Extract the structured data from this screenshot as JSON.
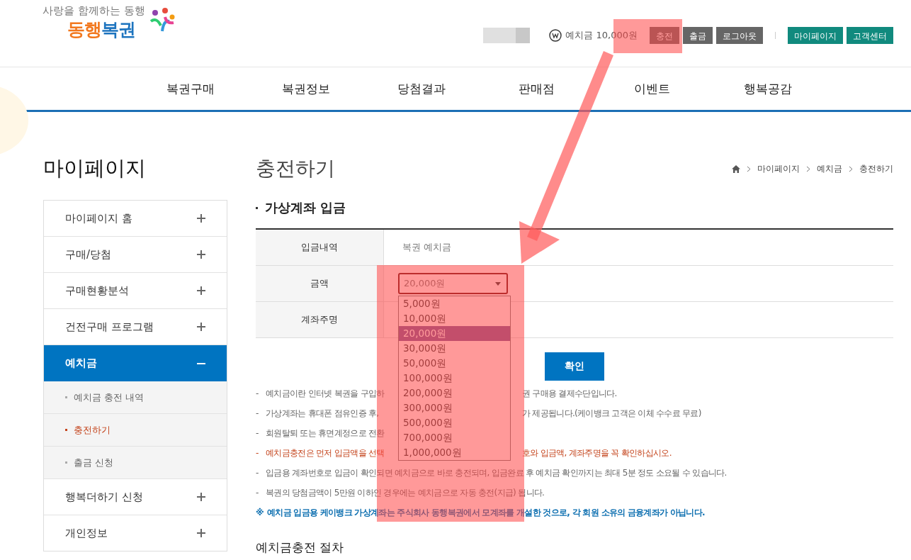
{
  "header": {
    "logo": {
      "tagline": "사랑을 함께하는 동행",
      "name_first": "동행",
      "name_second": "복권"
    },
    "balance_label": "예치금",
    "balance": "10,000원",
    "account_buttons": [
      {
        "label": "충전",
        "kind": "dark"
      },
      {
        "label": "출금",
        "kind": "dark"
      },
      {
        "label": "로그아웃",
        "kind": "dark"
      },
      {
        "label": "마이페이지",
        "kind": "accent"
      },
      {
        "label": "고객센터",
        "kind": "accent"
      }
    ]
  },
  "nav": [
    "복권구매",
    "복권정보",
    "당첨결과",
    "판매점",
    "이벤트",
    "행복공감"
  ],
  "sidebar": {
    "title": "마이페이지",
    "items": [
      {
        "label": "마이페이지 홈",
        "expanded": false,
        "selected": false
      },
      {
        "label": "구매/당첨",
        "expanded": false,
        "selected": false
      },
      {
        "label": "구매현황분석",
        "expanded": false,
        "selected": false
      },
      {
        "label": "건전구매 프로그램",
        "expanded": false,
        "selected": false
      },
      {
        "label": "예치금",
        "expanded": true,
        "selected": true,
        "children": [
          {
            "label": "예치금 충전 내역",
            "selected": false
          },
          {
            "label": "충전하기",
            "selected": true
          },
          {
            "label": "출금 신청",
            "selected": false
          }
        ]
      },
      {
        "label": "행복더하기 신청",
        "expanded": false,
        "selected": false
      },
      {
        "label": "개인정보",
        "expanded": false,
        "selected": false
      }
    ]
  },
  "page": {
    "title": "충전하기",
    "breadcrumb": [
      "마이페이지",
      "예치금",
      "충전하기"
    ]
  },
  "section_heading": "가상계좌 입금",
  "form": {
    "rows": [
      {
        "label": "입금내역",
        "kind": "text",
        "value": "복권 예치금"
      },
      {
        "label": "금액",
        "kind": "select",
        "value": "20,000원",
        "open": true,
        "options": [
          {
            "label": "5,000원",
            "selected": false
          },
          {
            "label": "10,000원",
            "selected": false
          },
          {
            "label": "20,000원",
            "selected": true
          },
          {
            "label": "30,000원",
            "selected": false
          },
          {
            "label": "50,000원",
            "selected": false
          },
          {
            "label": "100,000원",
            "selected": false
          },
          {
            "label": "200,000원",
            "selected": false
          },
          {
            "label": "300,000원",
            "selected": false
          },
          {
            "label": "500,000원",
            "selected": false
          },
          {
            "label": "700,000원",
            "selected": false
          },
          {
            "label": "1,000,000원",
            "selected": false
          }
        ]
      },
      {
        "label": "계좌주명",
        "kind": "blank"
      }
    ]
  },
  "confirm_button": "확인",
  "notes": [
    {
      "kind": "normal",
      "bullet": "-",
      "parts": [
        "예치금이란 인터넷 복권을 구입하",
        "권 구매용 결제수단입니다."
      ]
    },
    {
      "kind": "normal",
      "bullet": "-",
      "parts": [
        "가상계좌는 휴대폰 점유인증 후,",
        "가 제공됩니다.(케이뱅크 고객은 이체 수수료 무료)"
      ]
    },
    {
      "kind": "normal",
      "bullet": "-",
      "parts": [
        "회원탈퇴 또는 휴면계정으로 전환"
      ]
    },
    {
      "kind": "warning",
      "bullet": "-",
      "parts": [
        "예치금충전은 먼저 입금액을 선택",
        "호와 입금액, 계좌주명을 꼭 확인하십시오."
      ]
    },
    {
      "kind": "normal",
      "bullet": "-",
      "parts": [
        "입금용 계좌번호로 입금이 확인되면 예치금으로 바로 충전되며, 입금완료 후 예치금 확인까지는 최대 5분 정도 소요될 수 있습니다."
      ]
    },
    {
      "kind": "normal",
      "bullet": "-",
      "parts": [
        "복권의 당첨금액이 5만원 이하인 경우에는 예치금으로 자동 충전(지급) 됩니다."
      ]
    },
    {
      "kind": "notice",
      "bullet": "※",
      "parts": [
        "예치금 입금용 케이뱅크 가상계좌는 주식회사 동행복권에서 모계좌를 개설한 것으로, 각 회원 소유의 금융계좌가 아닙니다."
      ]
    }
  ],
  "procedure_heading": "예치금충전 절차"
}
